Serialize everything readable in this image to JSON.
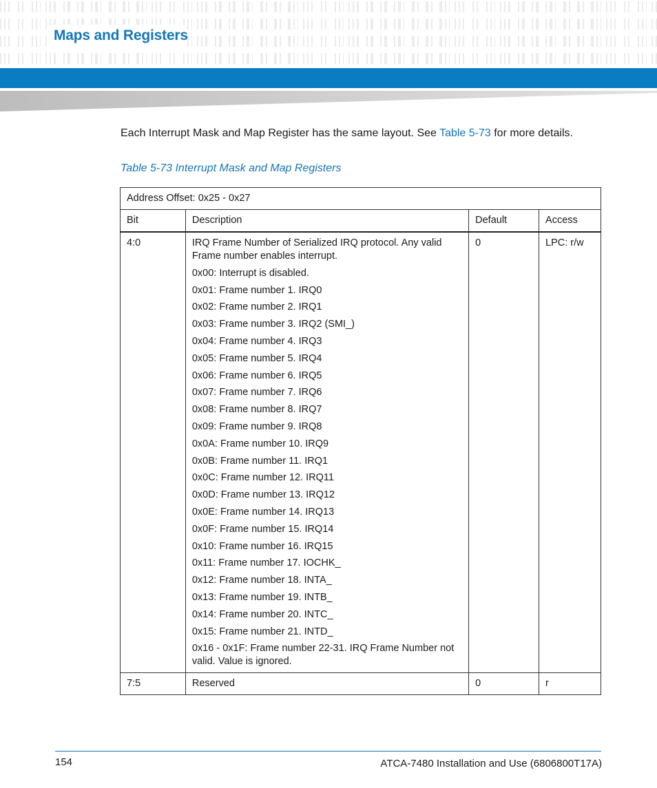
{
  "header": {
    "section_title": "Maps and Registers",
    "accent_color": "#0a7dc2"
  },
  "intro": {
    "before_link": "Each Interrupt Mask and Map Register has the same layout. See ",
    "link_text": "Table 5-73",
    "after_link": " for more details."
  },
  "table": {
    "caption": "Table 5-73 Interrupt Mask and Map Registers",
    "address_offset": "Address Offset: 0x25 - 0x27",
    "headers": [
      "Bit",
      "Description",
      "Default",
      "Access"
    ],
    "rows": [
      {
        "bit": "4:0",
        "description_lines": [
          "IRQ Frame Number of Serialized IRQ protocol. Any valid Frame number enables interrupt.",
          "0x00: Interrupt is disabled.",
          "0x01: Frame number 1. IRQ0",
          "0x02: Frame number 2. IRQ1",
          "0x03: Frame number 3. IRQ2 (SMI_)",
          "0x04: Frame number 4. IRQ3",
          "0x05: Frame number 5. IRQ4",
          "0x06: Frame number 6. IRQ5",
          "0x07: Frame number 7. IRQ6",
          "0x08: Frame number 8. IRQ7",
          "0x09: Frame number 9. IRQ8",
          "0x0A: Frame number 10. IRQ9",
          "0x0B: Frame number 11. IRQ1",
          "0x0C: Frame number 12. IRQ11",
          "0x0D: Frame number 13. IRQ12",
          "0x0E: Frame number 14. IRQ13",
          "0x0F: Frame number 15. IRQ14",
          "0x10: Frame number 16. IRQ15",
          "0x11: Frame number 17. IOCHK_",
          "0x12: Frame number 18. INTA_",
          "0x13: Frame number 19. INTB_",
          "0x14: Frame number 20. INTC_",
          "0x15: Frame number 21. INTD_",
          "0x16 - 0x1F: Frame number 22-31. IRQ Frame Number not valid. Value is ignored."
        ],
        "default": "0",
        "access": "LPC: r/w"
      },
      {
        "bit": "7:5",
        "description_lines": [
          "Reserved"
        ],
        "default": "0",
        "access": "r"
      }
    ]
  },
  "footer": {
    "page_number": "154",
    "document_title": "ATCA-7480 Installation and Use (6806800T17A)"
  }
}
